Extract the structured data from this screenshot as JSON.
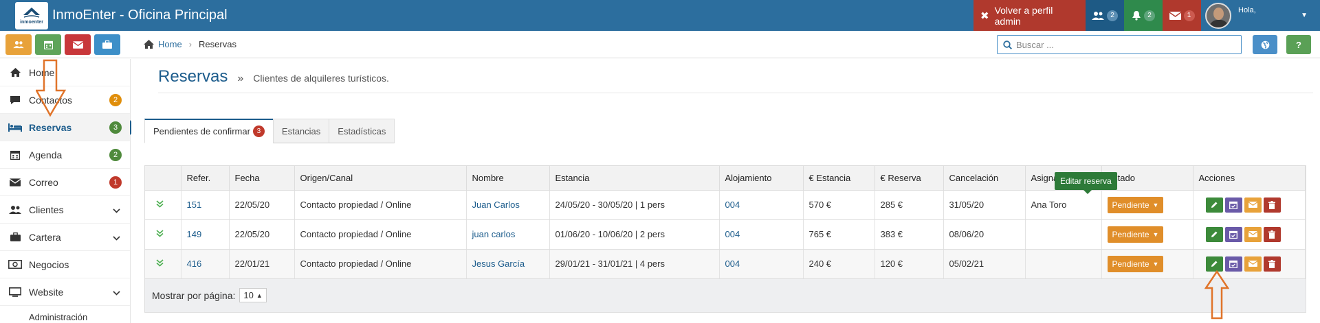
{
  "app": {
    "logo_text": "inmoenter",
    "title": "InmoEnter - Oficina Principal"
  },
  "topbar": {
    "admin_label": "Volver a perfil admin",
    "users_count": "2",
    "notifications_count": "2",
    "messages_count": "1",
    "greeting": "Hola,"
  },
  "subbar": {
    "breadcrumb_home": "Home",
    "breadcrumb_current": "Reservas",
    "search_placeholder": "Buscar ...",
    "help_label": "?"
  },
  "sidebar": {
    "items": [
      {
        "label": "Home",
        "icon": "home-icon"
      },
      {
        "label": "Contactos",
        "icon": "chat-icon",
        "badge": "2",
        "badge_color": "#e08e0b"
      },
      {
        "label": "Reservas",
        "icon": "bed-icon",
        "badge": "3",
        "badge_color": "#4f8a3c",
        "active": true
      },
      {
        "label": "Agenda",
        "icon": "calendar-icon",
        "badge": "2",
        "badge_color": "#4f8a3c"
      },
      {
        "label": "Correo",
        "icon": "envelope-icon",
        "badge": "1",
        "badge_color": "#c0392b"
      },
      {
        "label": "Clientes",
        "icon": "users-icon",
        "chevron": true
      },
      {
        "label": "Cartera",
        "icon": "briefcase-icon",
        "chevron": true
      },
      {
        "label": "Negocios",
        "icon": "money-icon"
      },
      {
        "label": "Website",
        "icon": "monitor-icon",
        "chevron": true
      },
      {
        "label": "Administración"
      }
    ]
  },
  "page": {
    "title": "Reservas",
    "raquo": "»",
    "subtitle": "Clientes de alquileres turísticos."
  },
  "tabs": [
    {
      "label": "Pendientes de confirmar",
      "badge": "3",
      "active": true
    },
    {
      "label": "Estancias"
    },
    {
      "label": "Estadísticas"
    }
  ],
  "table": {
    "columns": [
      "Refer.",
      "Fecha",
      "Origen/Canal",
      "Nombre",
      "Estancia",
      "Alojamiento",
      "€ Estancia",
      "€ Reserva",
      "Cancelación",
      "Asignado a",
      "Estado",
      "Acciones"
    ],
    "rows": [
      {
        "ref": "151",
        "fecha": "22/05/20",
        "origen": "Contacto propiedad / Online",
        "nombre": "Juan Carlos",
        "estancia": "24/05/20 - 30/05/20 | 1 pers",
        "alojamiento": "004",
        "e_estancia": "570 €",
        "e_reserva": "285 €",
        "cancelacion": "31/05/20",
        "asignado": "Ana Toro",
        "estado": "Pendiente"
      },
      {
        "ref": "149",
        "fecha": "22/05/20",
        "origen": "Contacto propiedad / Online",
        "nombre": "juan carlos",
        "estancia": "01/06/20 - 10/06/20 | 2 pers",
        "alojamiento": "004",
        "e_estancia": "765 €",
        "e_reserva": "383 €",
        "cancelacion": "08/06/20",
        "asignado": "",
        "estado": "Pendiente"
      },
      {
        "ref": "416",
        "fecha": "22/01/21",
        "origen": "Contacto propiedad / Online",
        "nombre": "Jesus García",
        "estancia": "29/01/21 - 31/01/21 | 4 pers",
        "alojamiento": "004",
        "e_estancia": "240 €",
        "e_reserva": "120 €",
        "cancelacion": "05/02/21",
        "asignado": "",
        "estado": "Pendiente"
      }
    ],
    "footer_label": "Mostrar por página:",
    "per_page": "10"
  },
  "tooltip": "Editar reserva",
  "colors": {
    "brand": "#2c6e9e",
    "active_blue": "#1c5c8c",
    "estado_orange": "#e08e2a",
    "annotation_arrow": "#e0742a"
  }
}
